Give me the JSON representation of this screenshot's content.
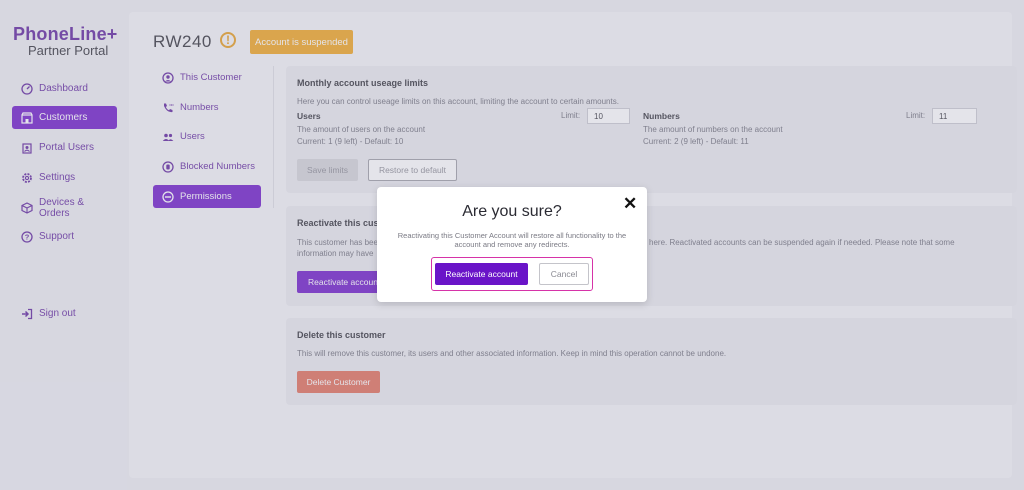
{
  "brand": {
    "name": "PhoneLine+",
    "subtitle": "Partner Portal"
  },
  "sidebar": {
    "items": [
      {
        "label": "Dashboard",
        "icon": "dashboard-icon"
      },
      {
        "label": "Customers",
        "icon": "store-icon",
        "active": true
      },
      {
        "label": "Portal Users",
        "icon": "badge-icon"
      },
      {
        "label": "Settings",
        "icon": "gear-icon"
      },
      {
        "label": "Devices & Orders",
        "icon": "box-icon"
      },
      {
        "label": "Support",
        "icon": "help-icon"
      }
    ],
    "signout": {
      "label": "Sign out",
      "icon": "signout-icon"
    }
  },
  "header": {
    "title": "RW240",
    "status_badge": "Account is suspended",
    "warning_icon": "warning-icon"
  },
  "subnav": {
    "items": [
      {
        "label": "This Customer",
        "icon": "user-circle-icon"
      },
      {
        "label": "Numbers",
        "icon": "phone-icon"
      },
      {
        "label": "Users",
        "icon": "users-icon"
      },
      {
        "label": "Blocked Numbers",
        "icon": "block-icon"
      },
      {
        "label": "Permissions",
        "icon": "minus-circle-icon",
        "active": true
      }
    ]
  },
  "limits_card": {
    "title": "Monthly account useage limits",
    "description": "Here you can control useage limits on this account, limiting the account to certain amounts.",
    "users": {
      "heading": "Users",
      "limit_label": "Limit:",
      "limit_value": "10",
      "desc": "The amount of users on the account",
      "current": "Current: 1 (9 left) - Default: 10"
    },
    "numbers": {
      "heading": "Numbers",
      "limit_label": "Limit:",
      "limit_value": "11",
      "desc": "The amount of numbers on the account",
      "current": "Current: 2 (9 left) - Default: 11"
    },
    "save_label": "Save limits",
    "restore_label": "Restore to default"
  },
  "reactivate_card": {
    "title": "Reactivate this cus",
    "text_line1_left": "This customer has bee",
    "text_line1_right": "here. Reactivated accounts can be suspended again if needed. Please note that some",
    "text_line2_left": "information may have",
    "button_label": "Reactivate account"
  },
  "delete_card": {
    "title": "Delete this customer",
    "description": "This will remove this customer, its users and other associated information. Keep in mind this operation cannot be undone.",
    "button_label": "Delete Customer"
  },
  "modal": {
    "title": "Are you sure?",
    "message": "Reactivating this Customer Account will restore all functionality to the account and remove any redirects.",
    "confirm_label": "Reactivate account",
    "cancel_label": "Cancel",
    "close_icon": "close-icon"
  },
  "colors": {
    "brand": "#5a1d9a",
    "accent": "#6a14c8",
    "warning": "#f0a318",
    "danger": "#e06a55",
    "highlight": "#d633a8"
  }
}
